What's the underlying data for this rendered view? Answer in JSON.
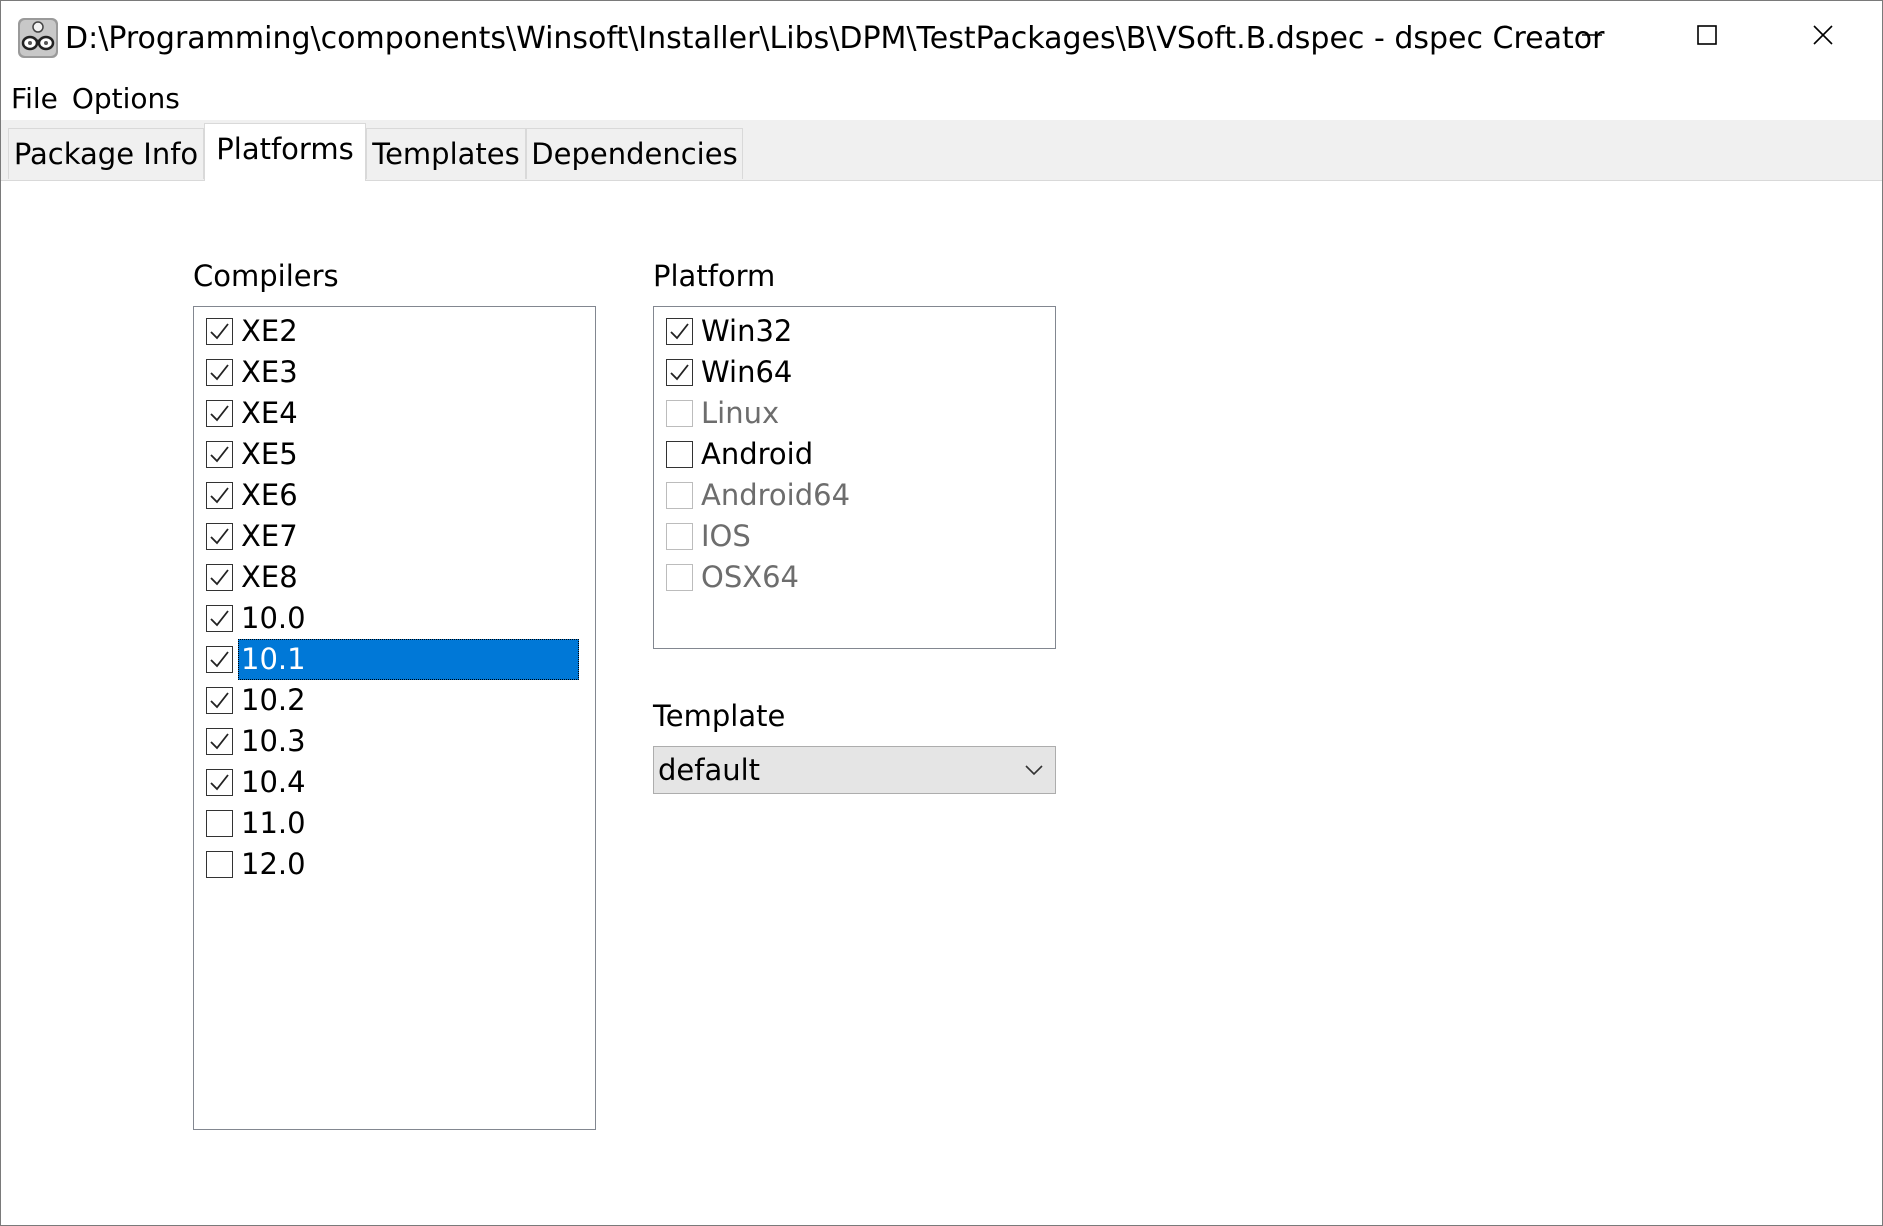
{
  "window": {
    "title": "D:\\Programming\\components\\Winsoft\\Installer\\Libs\\DPM\\TestPackages\\B\\VSoft.B.dspec - dspec Creator",
    "icon": "glasses-app-icon",
    "controls": [
      "minimize-icon",
      "maximize-icon",
      "close-icon"
    ]
  },
  "menu": {
    "file": "File",
    "options": "Options"
  },
  "tabs": [
    {
      "label": "Package Info",
      "active": false
    },
    {
      "label": "Platforms",
      "active": true
    },
    {
      "label": "Templates",
      "active": false
    },
    {
      "label": "Dependencies",
      "active": false
    }
  ],
  "compilers": {
    "label": "Compilers",
    "items": [
      {
        "label": "XE2",
        "checked": true
      },
      {
        "label": "XE3",
        "checked": true
      },
      {
        "label": "XE4",
        "checked": true
      },
      {
        "label": "XE5",
        "checked": true
      },
      {
        "label": "XE6",
        "checked": true
      },
      {
        "label": "XE7",
        "checked": true
      },
      {
        "label": "XE8",
        "checked": true
      },
      {
        "label": "10.0",
        "checked": true
      },
      {
        "label": "10.1",
        "checked": true,
        "selected": true
      },
      {
        "label": "10.2",
        "checked": true
      },
      {
        "label": "10.3",
        "checked": true
      },
      {
        "label": "10.4",
        "checked": true
      },
      {
        "label": "11.0",
        "checked": false
      },
      {
        "label": "12.0",
        "checked": false
      }
    ]
  },
  "platform": {
    "label": "Platform",
    "items": [
      {
        "label": "Win32",
        "checked": true,
        "enabled": true
      },
      {
        "label": "Win64",
        "checked": true,
        "enabled": true
      },
      {
        "label": "Linux",
        "checked": false,
        "enabled": false
      },
      {
        "label": "Android",
        "checked": false,
        "enabled": true
      },
      {
        "label": "Android64",
        "checked": false,
        "enabled": false
      },
      {
        "label": "IOS",
        "checked": false,
        "enabled": false
      },
      {
        "label": "OSX64",
        "checked": false,
        "enabled": false
      }
    ]
  },
  "template": {
    "label": "Template",
    "value": "default"
  },
  "colors": {
    "selection": "#0078d7",
    "tab_strip": "#f0f0f0",
    "disabled_text": "#6d6d6d"
  }
}
